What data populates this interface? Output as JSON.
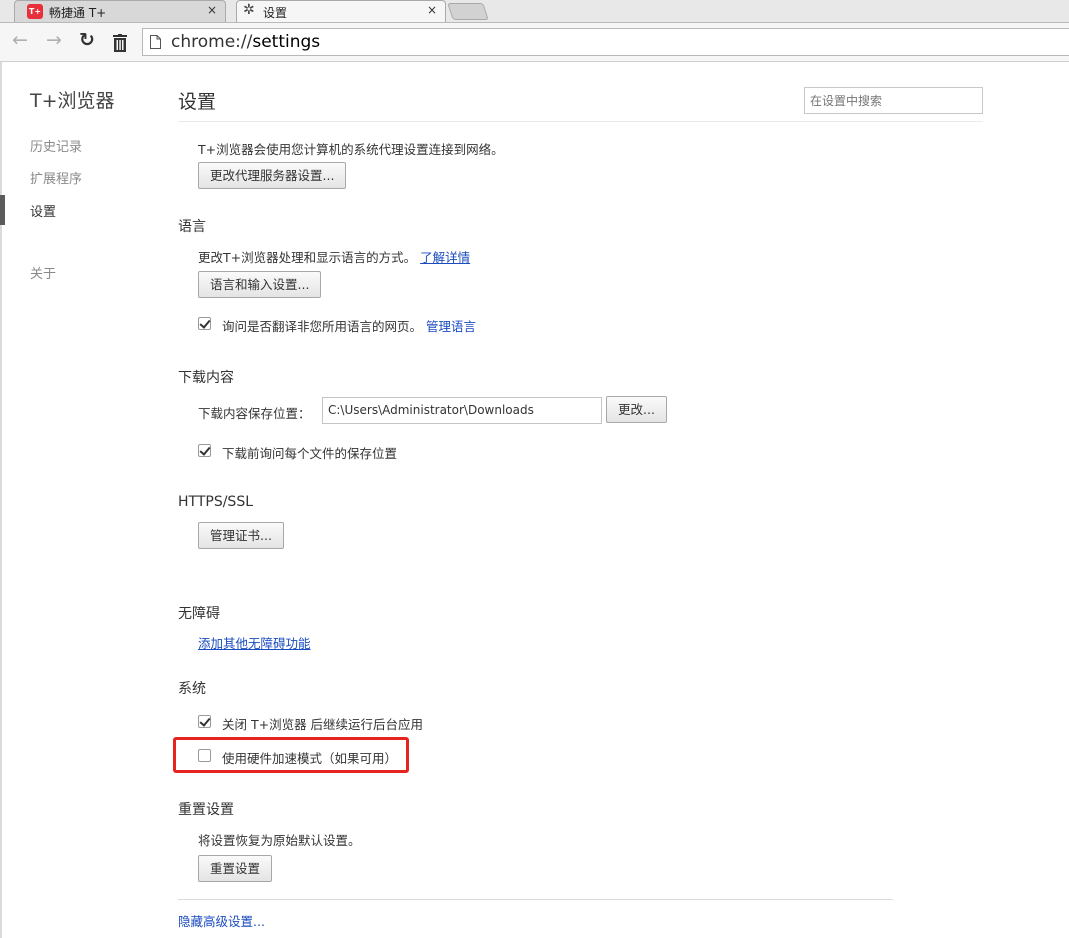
{
  "tabs": [
    {
      "title": "畅捷通 T+",
      "logo_text": "T+",
      "close": "×"
    },
    {
      "title": "设置",
      "close": "×"
    }
  ],
  "toolbar": {
    "address_scheme": "chrome://",
    "address_host": "settings"
  },
  "sidebar": {
    "brand": "T+浏览器",
    "items": [
      {
        "label": "历史记录"
      },
      {
        "label": "扩展程序"
      },
      {
        "label": "设置"
      },
      {
        "label": "关于"
      }
    ]
  },
  "main": {
    "title": "设置",
    "search_placeholder": "在设置中搜索",
    "network": {
      "description": "T+浏览器会使用您计算机的系统代理设置连接到网络。",
      "proxy_button": "更改代理服务器设置..."
    },
    "language": {
      "title": "语言",
      "description": "更改T+浏览器处理和显示语言的方式。",
      "learn_more": "了解详情",
      "settings_button": "语言和输入设置...",
      "translate_label": "询问是否翻译非您所用语言的网页。",
      "manage_link": "管理语言"
    },
    "downloads": {
      "title": "下载内容",
      "location_label": "下载内容保存位置：",
      "location_value": "C:\\Users\\Administrator\\Downloads",
      "change_button": "更改...",
      "ask_label": "下载前询问每个文件的保存位置"
    },
    "https": {
      "title": "HTTPS/SSL",
      "cert_button": "管理证书..."
    },
    "accessibility": {
      "title": "无障碍",
      "add_link": "添加其他无障碍功能"
    },
    "system": {
      "title": "系统",
      "background_label": "关闭 T+浏览器 后继续运行后台应用",
      "hardware_label": "使用硬件加速模式（如果可用）"
    },
    "reset": {
      "title": "重置设置",
      "description": "将设置恢复为原始默认设置。",
      "button": "重置设置"
    },
    "hide_advanced": "隐藏高级设置..."
  }
}
